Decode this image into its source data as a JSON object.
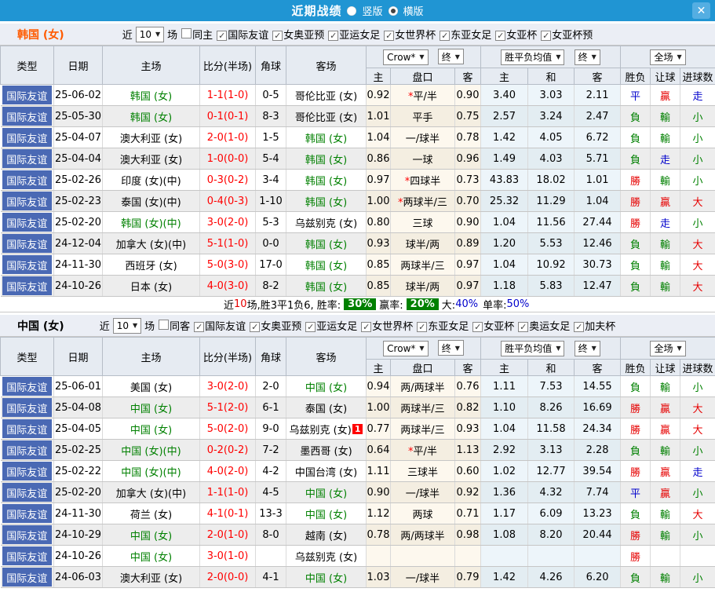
{
  "ui": {
    "caret": "▼",
    "check": "✓",
    "close_icon": "✕"
  },
  "colors": {
    "titlebar_blue": "#2095d3",
    "type_cell_blue": "#4a69b4",
    "win_red": "#e60000",
    "lose_green": "#008000",
    "draw_blue": "#0000cc",
    "score_red": "#ff0000",
    "korea_title_orange": "#ff5a00",
    "rate_badge_green": "#008000"
  },
  "titlebar": {
    "title": "近期战绩",
    "radio_vertical": "竖版",
    "radio_horizontal": "横版"
  },
  "sections": [
    {
      "team": "韩国 (女)",
      "filter": {
        "near_label": "近",
        "games_value": "10",
        "games_label": "场",
        "checkboxes": [
          {
            "label": "同主",
            "checked": false
          },
          {
            "label": "国际友谊",
            "checked": true
          },
          {
            "label": "女奥亚预",
            "checked": true
          },
          {
            "label": "亚运女足",
            "checked": true
          },
          {
            "label": "女世界杯",
            "checked": true
          },
          {
            "label": "东亚女足",
            "checked": true
          },
          {
            "label": "女亚杯",
            "checked": true
          },
          {
            "label": "女亚杯预",
            "checked": true
          }
        ]
      },
      "table": {
        "cols": [
          "类型",
          "日期",
          "主场",
          "比分(半场)",
          "角球",
          "客场"
        ],
        "sub": [
          "主",
          "盘口",
          "客",
          "主",
          "和",
          "客",
          "胜负",
          "让球",
          "进球数"
        ],
        "bookmaker": "Crow*",
        "final_label": "终",
        "mean_label": "胜平负均值",
        "full_label": "全场"
      },
      "rows": [
        {
          "type": "国际友谊",
          "date": "25-06-02",
          "home": "韩国 (女)",
          "home_green": true,
          "score": "1-1(1-0)",
          "corner": "0-5",
          "away": "哥伦比亚 (女)",
          "away_green": false,
          "away_badge": "",
          "odds_home": "0.92",
          "handicap": "平/半",
          "handicap_star": true,
          "odds_away": "0.90",
          "mean_home": "3.40",
          "mean_draw": "3.03",
          "mean_away": "2.11",
          "result": {
            "t": "平",
            "c": "b"
          },
          "handicap_result": {
            "t": "贏",
            "c": "r"
          },
          "goals_result": {
            "t": "走",
            "c": "b"
          }
        },
        {
          "type": "国际友谊",
          "date": "25-05-30",
          "home": "韩国 (女)",
          "home_green": true,
          "score": "0-1(0-1)",
          "corner": "8-3",
          "away": "哥伦比亚 (女)",
          "away_green": false,
          "away_badge": "",
          "odds_home": "1.01",
          "handicap": "平手",
          "handicap_star": false,
          "odds_away": "0.75",
          "mean_home": "2.57",
          "mean_draw": "3.24",
          "mean_away": "2.47",
          "result": {
            "t": "負",
            "c": "g"
          },
          "handicap_result": {
            "t": "輸",
            "c": "g"
          },
          "goals_result": {
            "t": "小",
            "c": "g"
          }
        },
        {
          "type": "国际友谊",
          "date": "25-04-07",
          "home": "澳大利亚 (女)",
          "home_green": false,
          "score": "2-0(1-0)",
          "corner": "1-5",
          "away": "韩国 (女)",
          "away_green": true,
          "away_badge": "",
          "odds_home": "1.04",
          "handicap": "一/球半",
          "handicap_star": false,
          "odds_away": "0.78",
          "mean_home": "1.42",
          "mean_draw": "4.05",
          "mean_away": "6.72",
          "result": {
            "t": "負",
            "c": "g"
          },
          "handicap_result": {
            "t": "輸",
            "c": "g"
          },
          "goals_result": {
            "t": "小",
            "c": "g"
          }
        },
        {
          "type": "国际友谊",
          "date": "25-04-04",
          "home": "澳大利亚 (女)",
          "home_green": false,
          "score": "1-0(0-0)",
          "corner": "5-4",
          "away": "韩国 (女)",
          "away_green": true,
          "away_badge": "",
          "odds_home": "0.86",
          "handicap": "一球",
          "handicap_star": false,
          "odds_away": "0.96",
          "mean_home": "1.49",
          "mean_draw": "4.03",
          "mean_away": "5.71",
          "result": {
            "t": "負",
            "c": "g"
          },
          "handicap_result": {
            "t": "走",
            "c": "b"
          },
          "goals_result": {
            "t": "小",
            "c": "g"
          }
        },
        {
          "type": "国际友谊",
          "date": "25-02-26",
          "home": "印度 (女)(中)",
          "home_green": false,
          "score": "0-3(0-2)",
          "corner": "3-4",
          "away": "韩国 (女)",
          "away_green": true,
          "away_badge": "",
          "odds_home": "0.97",
          "handicap": "四球半",
          "handicap_star": true,
          "odds_away": "0.73",
          "mean_home": "43.83",
          "mean_draw": "18.02",
          "mean_away": "1.01",
          "result": {
            "t": "勝",
            "c": "r"
          },
          "handicap_result": {
            "t": "輸",
            "c": "g"
          },
          "goals_result": {
            "t": "小",
            "c": "g"
          }
        },
        {
          "type": "国际友谊",
          "date": "25-02-23",
          "home": "泰国 (女)(中)",
          "home_green": false,
          "score": "0-4(0-3)",
          "corner": "1-10",
          "away": "韩国 (女)",
          "away_green": true,
          "away_badge": "",
          "odds_home": "1.00",
          "handicap": "两球半/三",
          "handicap_star": true,
          "odds_away": "0.70",
          "mean_home": "25.32",
          "mean_draw": "11.29",
          "mean_away": "1.04",
          "result": {
            "t": "勝",
            "c": "r"
          },
          "handicap_result": {
            "t": "贏",
            "c": "r"
          },
          "goals_result": {
            "t": "大",
            "c": "r"
          }
        },
        {
          "type": "国际友谊",
          "date": "25-02-20",
          "home": "韩国 (女)(中)",
          "home_green": true,
          "score": "3-0(2-0)",
          "corner": "5-3",
          "away": "乌兹别克 (女)",
          "away_green": false,
          "away_badge": "",
          "odds_home": "0.80",
          "handicap": "三球",
          "handicap_star": false,
          "odds_away": "0.90",
          "mean_home": "1.04",
          "mean_draw": "11.56",
          "mean_away": "27.44",
          "result": {
            "t": "勝",
            "c": "r"
          },
          "handicap_result": {
            "t": "走",
            "c": "b"
          },
          "goals_result": {
            "t": "小",
            "c": "g"
          }
        },
        {
          "type": "国际友谊",
          "date": "24-12-04",
          "home": "加拿大 (女)(中)",
          "home_green": false,
          "score": "5-1(1-0)",
          "corner": "0-0",
          "away": "韩国 (女)",
          "away_green": true,
          "away_badge": "",
          "odds_home": "0.93",
          "handicap": "球半/两",
          "handicap_star": false,
          "odds_away": "0.89",
          "mean_home": "1.20",
          "mean_draw": "5.53",
          "mean_away": "12.46",
          "result": {
            "t": "負",
            "c": "g"
          },
          "handicap_result": {
            "t": "輸",
            "c": "g"
          },
          "goals_result": {
            "t": "大",
            "c": "r"
          }
        },
        {
          "type": "国际友谊",
          "date": "24-11-30",
          "home": "西班牙 (女)",
          "home_green": false,
          "score": "5-0(3-0)",
          "corner": "17-0",
          "away": "韩国 (女)",
          "away_green": true,
          "away_badge": "",
          "odds_home": "0.85",
          "handicap": "两球半/三",
          "handicap_star": false,
          "odds_away": "0.97",
          "mean_home": "1.04",
          "mean_draw": "10.92",
          "mean_away": "30.73",
          "result": {
            "t": "負",
            "c": "g"
          },
          "handicap_result": {
            "t": "輸",
            "c": "g"
          },
          "goals_result": {
            "t": "大",
            "c": "r"
          }
        },
        {
          "type": "国际友谊",
          "date": "24-10-26",
          "home": "日本 (女)",
          "home_green": false,
          "score": "4-0(3-0)",
          "corner": "8-2",
          "away": "韩国 (女)",
          "away_green": true,
          "away_badge": "",
          "odds_home": "0.85",
          "handicap": "球半/两",
          "handicap_star": false,
          "odds_away": "0.97",
          "mean_home": "1.18",
          "mean_draw": "5.83",
          "mean_away": "12.47",
          "result": {
            "t": "負",
            "c": "g"
          },
          "handicap_result": {
            "t": "輸",
            "c": "g"
          },
          "goals_result": {
            "t": "大",
            "c": "r"
          }
        }
      ],
      "summary": {
        "prefix": "近",
        "count": "10",
        "mid": "场,胜3平1负6, 胜率:",
        "win_rate": "30%",
        "win_label": "赢率:",
        "handicap_rate": "20%",
        "big_label": "大:",
        "big_rate": "40%",
        "odd_label": "单率:",
        "odd_rate": "50%"
      }
    },
    {
      "team": "中国 (女)",
      "filter": {
        "near_label": "近",
        "games_value": "10",
        "games_label": "场",
        "checkboxes": [
          {
            "label": "同客",
            "checked": false
          },
          {
            "label": "国际友谊",
            "checked": true
          },
          {
            "label": "女奥亚预",
            "checked": true
          },
          {
            "label": "亚运女足",
            "checked": true
          },
          {
            "label": "女世界杯",
            "checked": true
          },
          {
            "label": "东亚女足",
            "checked": true
          },
          {
            "label": "女亚杯",
            "checked": true
          },
          {
            "label": "奥运女足",
            "checked": true
          },
          {
            "label": "加夫杯",
            "checked": true
          }
        ]
      },
      "table": {
        "cols": [
          "类型",
          "日期",
          "主场",
          "比分(半场)",
          "角球",
          "客场"
        ],
        "sub": [
          "主",
          "盘口",
          "客",
          "主",
          "和",
          "客",
          "胜负",
          "让球",
          "进球数"
        ],
        "bookmaker": "Crow*",
        "final_label": "终",
        "mean_label": "胜平负均值",
        "full_label": "全场"
      },
      "rows": [
        {
          "type": "国际友谊",
          "date": "25-06-01",
          "home": "美国 (女)",
          "home_green": false,
          "score": "3-0(2-0)",
          "corner": "2-0",
          "away": "中国 (女)",
          "away_green": true,
          "away_badge": "",
          "odds_home": "0.94",
          "handicap": "两/两球半",
          "handicap_star": false,
          "odds_away": "0.76",
          "mean_home": "1.11",
          "mean_draw": "7.53",
          "mean_away": "14.55",
          "result": {
            "t": "負",
            "c": "g"
          },
          "handicap_result": {
            "t": "輸",
            "c": "g"
          },
          "goals_result": {
            "t": "小",
            "c": "g"
          }
        },
        {
          "type": "国际友谊",
          "date": "25-04-08",
          "home": "中国 (女)",
          "home_green": true,
          "score": "5-1(2-0)",
          "corner": "6-1",
          "away": "泰国 (女)",
          "away_green": false,
          "away_badge": "",
          "odds_home": "1.00",
          "handicap": "两球半/三",
          "handicap_star": false,
          "odds_away": "0.82",
          "mean_home": "1.10",
          "mean_draw": "8.26",
          "mean_away": "16.69",
          "result": {
            "t": "勝",
            "c": "r"
          },
          "handicap_result": {
            "t": "贏",
            "c": "r"
          },
          "goals_result": {
            "t": "大",
            "c": "r"
          }
        },
        {
          "type": "国际友谊",
          "date": "25-04-05",
          "home": "中国 (女)",
          "home_green": true,
          "score": "5-0(2-0)",
          "corner": "9-0",
          "away": "乌兹别克 (女)",
          "away_green": false,
          "away_badge": "1",
          "odds_home": "0.77",
          "handicap": "两球半/三",
          "handicap_star": false,
          "odds_away": "0.93",
          "mean_home": "1.04",
          "mean_draw": "11.58",
          "mean_away": "24.34",
          "result": {
            "t": "勝",
            "c": "r"
          },
          "handicap_result": {
            "t": "贏",
            "c": "r"
          },
          "goals_result": {
            "t": "大",
            "c": "r"
          }
        },
        {
          "type": "国际友谊",
          "date": "25-02-25",
          "home": "中国 (女)(中)",
          "home_green": true,
          "score": "0-2(0-2)",
          "corner": "7-2",
          "away": "墨西哥 (女)",
          "away_green": false,
          "away_badge": "",
          "odds_home": "0.64",
          "handicap": "平/半",
          "handicap_star": true,
          "odds_away": "1.13",
          "mean_home": "2.92",
          "mean_draw": "3.13",
          "mean_away": "2.28",
          "result": {
            "t": "負",
            "c": "g"
          },
          "handicap_result": {
            "t": "輸",
            "c": "g"
          },
          "goals_result": {
            "t": "小",
            "c": "g"
          }
        },
        {
          "type": "国际友谊",
          "date": "25-02-22",
          "home": "中国 (女)(中)",
          "home_green": true,
          "score": "4-0(2-0)",
          "corner": "4-2",
          "away": "中国台湾 (女)",
          "away_green": false,
          "away_badge": "",
          "odds_home": "1.11",
          "handicap": "三球半",
          "handicap_star": false,
          "odds_away": "0.60",
          "mean_home": "1.02",
          "mean_draw": "12.77",
          "mean_away": "39.54",
          "result": {
            "t": "勝",
            "c": "r"
          },
          "handicap_result": {
            "t": "贏",
            "c": "r"
          },
          "goals_result": {
            "t": "走",
            "c": "b"
          }
        },
        {
          "type": "国际友谊",
          "date": "25-02-20",
          "home": "加拿大 (女)(中)",
          "home_green": false,
          "score": "1-1(1-0)",
          "corner": "4-5",
          "away": "中国 (女)",
          "away_green": true,
          "away_badge": "",
          "odds_home": "0.90",
          "handicap": "一/球半",
          "handicap_star": false,
          "odds_away": "0.92",
          "mean_home": "1.36",
          "mean_draw": "4.32",
          "mean_away": "7.74",
          "result": {
            "t": "平",
            "c": "b"
          },
          "handicap_result": {
            "t": "贏",
            "c": "r"
          },
          "goals_result": {
            "t": "小",
            "c": "g"
          }
        },
        {
          "type": "国际友谊",
          "date": "24-11-30",
          "home": "荷兰 (女)",
          "home_green": false,
          "score": "4-1(0-1)",
          "corner": "13-3",
          "away": "中国 (女)",
          "away_green": true,
          "away_badge": "",
          "odds_home": "1.12",
          "handicap": "两球",
          "handicap_star": false,
          "odds_away": "0.71",
          "mean_home": "1.17",
          "mean_draw": "6.09",
          "mean_away": "13.23",
          "result": {
            "t": "負",
            "c": "g"
          },
          "handicap_result": {
            "t": "輸",
            "c": "g"
          },
          "goals_result": {
            "t": "大",
            "c": "r"
          }
        },
        {
          "type": "国际友谊",
          "date": "24-10-29",
          "home": "中国 (女)",
          "home_green": true,
          "score": "2-0(1-0)",
          "corner": "8-0",
          "away": "越南 (女)",
          "away_green": false,
          "away_badge": "",
          "odds_home": "0.78",
          "handicap": "两/两球半",
          "handicap_star": false,
          "odds_away": "0.98",
          "mean_home": "1.08",
          "mean_draw": "8.20",
          "mean_away": "20.44",
          "result": {
            "t": "勝",
            "c": "r"
          },
          "handicap_result": {
            "t": "輸",
            "c": "g"
          },
          "goals_result": {
            "t": "小",
            "c": "g"
          }
        },
        {
          "type": "国际友谊",
          "date": "24-10-26",
          "home": "中国 (女)",
          "home_green": true,
          "score": "3-0(1-0)",
          "corner": "",
          "away": "乌兹别克 (女)",
          "away_green": false,
          "away_badge": "",
          "odds_home": "",
          "handicap": "",
          "handicap_star": false,
          "odds_away": "",
          "mean_home": "",
          "mean_draw": "",
          "mean_away": "",
          "result": {
            "t": "勝",
            "c": "r"
          },
          "handicap_result": {
            "t": "",
            "c": ""
          },
          "goals_result": {
            "t": "",
            "c": ""
          }
        },
        {
          "type": "国际友谊",
          "date": "24-06-03",
          "home": "澳大利亚 (女)",
          "home_green": false,
          "score": "2-0(0-0)",
          "corner": "4-1",
          "away": "中国 (女)",
          "away_green": true,
          "away_badge": "",
          "odds_home": "1.03",
          "handicap": "一/球半",
          "handicap_star": false,
          "odds_away": "0.79",
          "mean_home": "1.42",
          "mean_draw": "4.26",
          "mean_away": "6.20",
          "result": {
            "t": "負",
            "c": "g"
          },
          "handicap_result": {
            "t": "輸",
            "c": "g"
          },
          "goals_result": {
            "t": "小",
            "c": "g"
          }
        }
      ],
      "summary": null
    }
  ]
}
